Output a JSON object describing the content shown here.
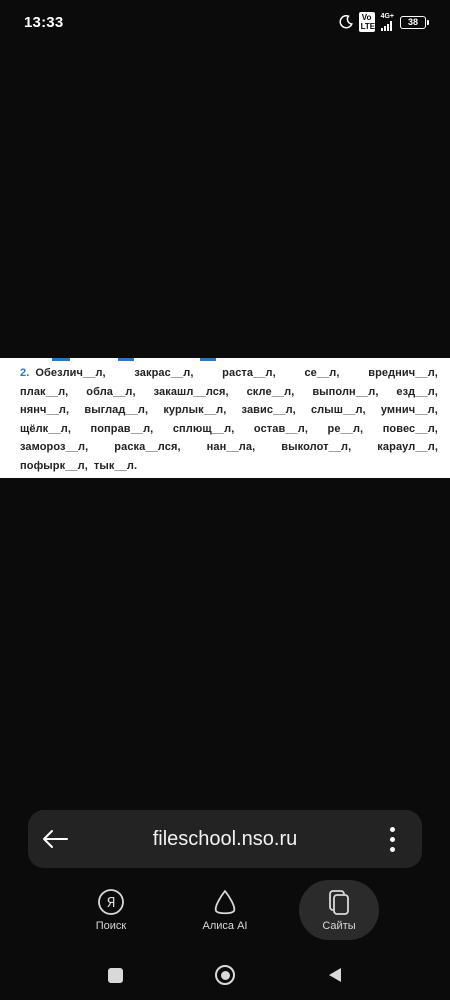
{
  "status_bar": {
    "time": "13:33",
    "volte_label": "Vo LTE",
    "network_label": "4G+",
    "battery_level": "38",
    "icons": [
      "moon-icon",
      "volte-icon",
      "signal-icon",
      "battery-icon"
    ]
  },
  "content": {
    "exercise_number": "2.",
    "lines": [
      [
        "Обезлич__л,",
        "закрас__л,",
        "раста__л,",
        "се__л,",
        "вреднич__л,"
      ],
      [
        "плак__л,",
        "обла__л,",
        "закашл__лся,",
        "скле__л,",
        "выполн__л,",
        "езд__л,"
      ],
      [
        "нянч__л,",
        "выглад__л,",
        "курлык__л,",
        "завис__л,",
        "слыш__л,",
        "умнич__л,"
      ],
      [
        "щёлк__л,",
        "поправ__л,",
        "сплющ__л,",
        "остав__л,",
        "ре__л,",
        "повес__л,"
      ],
      [
        "замороз__л,",
        "раска__лся,",
        "нан__ла,",
        "выколот__л,",
        "караул__л,"
      ],
      [
        "пофырк__л,",
        "тык__л."
      ]
    ]
  },
  "browser": {
    "url": "fileschool.nso.ru",
    "icons": {
      "back": "back-arrow-icon",
      "menu": "more-vertical-icon"
    }
  },
  "tabs": [
    {
      "label": "Поиск",
      "icon": "yandex-search-icon",
      "active": false
    },
    {
      "label": "Алиса AI",
      "icon": "alice-icon",
      "active": false
    },
    {
      "label": "Сайты",
      "icon": "sites-icon",
      "active": true
    }
  ],
  "colors": {
    "background": "#0b0b0b",
    "address_bar": "#232323",
    "accent_blue": "#2a76c6",
    "active_tab": "#2b2b2b"
  }
}
